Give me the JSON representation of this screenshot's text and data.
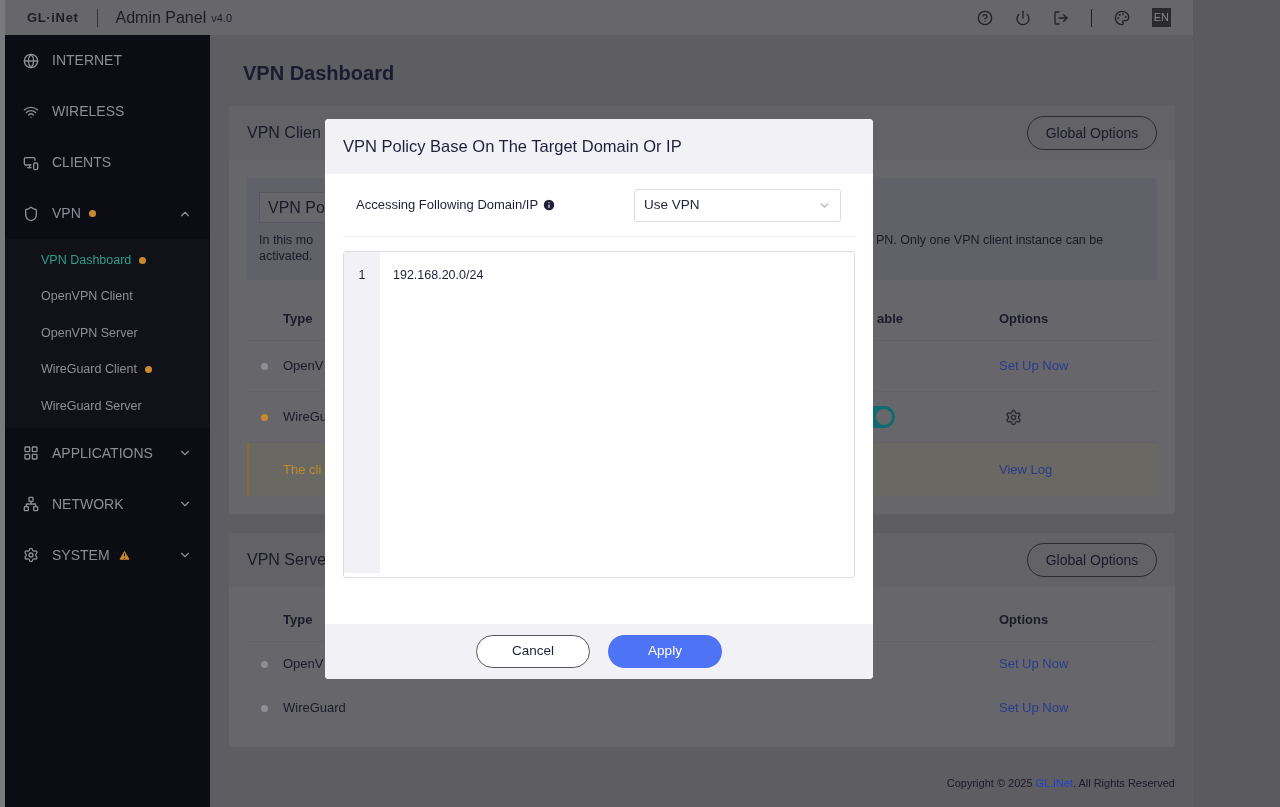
{
  "header": {
    "logo": "GL·iNet",
    "title": "Admin Panel",
    "version": "v4.0",
    "language": "EN"
  },
  "sidebar": {
    "items": [
      {
        "label": "INTERNET"
      },
      {
        "label": "WIRELESS"
      },
      {
        "label": "CLIENTS"
      },
      {
        "label": "VPN",
        "dot": true,
        "expanded": true,
        "children": [
          {
            "label": "VPN Dashboard",
            "selected": true,
            "dot": true
          },
          {
            "label": "OpenVPN Client",
            "selected": false
          },
          {
            "label": "OpenVPN Server",
            "selected": false
          },
          {
            "label": "WireGuard Client",
            "selected": false,
            "dot": true
          },
          {
            "label": "WireGuard Server",
            "selected": false
          }
        ]
      },
      {
        "label": "APPLICATIONS",
        "expanded": false
      },
      {
        "label": "NETWORK",
        "expanded": false
      },
      {
        "label": "SYSTEM",
        "warning": true,
        "expanded": false
      }
    ]
  },
  "page_title": "VPN Dashboard",
  "client_card": {
    "title": "VPN Clien",
    "button": "Global Options",
    "policy": {
      "tab": "VPN Po",
      "text_left": [
        "In this mo",
        "activated."
      ],
      "text_right": "PN. Only one VPN client instance can be"
    },
    "columns": [
      "Type",
      "able",
      "Options"
    ],
    "rows": [
      {
        "color": "#8e8e94",
        "type": "OpenV",
        "toggle": false,
        "kind": "link",
        "option": "Set Up Now"
      },
      {
        "color": "#c98a2e",
        "type": "WireGu",
        "toggle": true,
        "kind": "gear"
      }
    ],
    "alert": {
      "text": "The cli",
      "link": "View Log"
    }
  },
  "server_card": {
    "title": "VPN Serve",
    "button": "Global Options",
    "columns": [
      "Type",
      "Options"
    ],
    "rows": [
      {
        "color": "#8e8e94",
        "type": "OpenV",
        "option": "Set Up Now"
      },
      {
        "color": "#8e8e94",
        "type": "WireGuard",
        "option": "Set Up Now"
      }
    ]
  },
  "footer": {
    "before": "Copyright © 2025 ",
    "link": "GL.iNet",
    "after": ". All Rights Reserved"
  },
  "modal": {
    "title": "VPN Policy Base On The Target Domain Or IP",
    "label": "Accessing Following Domain/IP",
    "select": "Use VPN",
    "lines": [
      {
        "number": "1",
        "text": "192.168.20.0/24"
      }
    ],
    "buttons": [
      {
        "label": "Cancel",
        "kind": "secondary"
      },
      {
        "label": "Apply",
        "kind": "primary"
      }
    ]
  }
}
